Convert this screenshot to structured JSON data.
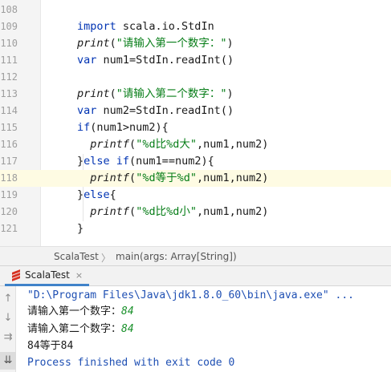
{
  "editor": {
    "lines": [
      {
        "num": "108",
        "tokens": []
      },
      {
        "num": "109",
        "tokens": [
          {
            "t": "kw",
            "v": "import "
          },
          {
            "t": "plain",
            "v": "scala.io.StdIn"
          }
        ]
      },
      {
        "num": "110",
        "tokens": [
          {
            "t": "fn",
            "v": "print"
          },
          {
            "t": "plain",
            "v": "("
          },
          {
            "t": "str",
            "v": "\"请输入第一个数字：\""
          },
          {
            "t": "plain",
            "v": ")"
          }
        ]
      },
      {
        "num": "111",
        "tokens": [
          {
            "t": "kw",
            "v": "var "
          },
          {
            "t": "plain",
            "v": "num1=StdIn.readInt()"
          }
        ]
      },
      {
        "num": "112",
        "tokens": []
      },
      {
        "num": "113",
        "tokens": [
          {
            "t": "fn",
            "v": "print"
          },
          {
            "t": "plain",
            "v": "("
          },
          {
            "t": "str",
            "v": "\"请输入第二个数字：\""
          },
          {
            "t": "plain",
            "v": ")"
          }
        ]
      },
      {
        "num": "114",
        "tokens": [
          {
            "t": "kw",
            "v": "var "
          },
          {
            "t": "plain",
            "v": "num2=StdIn.readInt()"
          }
        ]
      },
      {
        "num": "115",
        "tokens": [
          {
            "t": "kw",
            "v": "if"
          },
          {
            "t": "plain",
            "v": "(num1>num2){"
          }
        ]
      },
      {
        "num": "116",
        "tokens": [
          {
            "t": "plain",
            "v": "  "
          },
          {
            "t": "fn",
            "v": "printf"
          },
          {
            "t": "plain",
            "v": "("
          },
          {
            "t": "str",
            "v": "\"%d比%d大\""
          },
          {
            "t": "plain",
            "v": ",num1,num2)"
          }
        ]
      },
      {
        "num": "117",
        "tokens": [
          {
            "t": "plain",
            "v": "}"
          },
          {
            "t": "kw",
            "v": "else if"
          },
          {
            "t": "plain",
            "v": "(num1==num2){"
          }
        ]
      },
      {
        "num": "118",
        "current": true,
        "tokens": [
          {
            "t": "plain",
            "v": "  "
          },
          {
            "t": "fn",
            "v": "printf"
          },
          {
            "t": "plain",
            "v": "("
          },
          {
            "t": "str",
            "v": "\"%d等于%d\""
          },
          {
            "t": "plain",
            "v": ",num1,num2)"
          }
        ]
      },
      {
        "num": "119",
        "tokens": [
          {
            "t": "plain",
            "v": "}"
          },
          {
            "t": "kw",
            "v": "else"
          },
          {
            "t": "plain",
            "v": "{"
          }
        ]
      },
      {
        "num": "120",
        "tokens": [
          {
            "t": "plain",
            "v": "  "
          },
          {
            "t": "fn",
            "v": "printf"
          },
          {
            "t": "plain",
            "v": "("
          },
          {
            "t": "str",
            "v": "\"%d比%d小\""
          },
          {
            "t": "plain",
            "v": ",num1,num2)"
          }
        ]
      },
      {
        "num": "121",
        "tokens": [
          {
            "t": "plain",
            "v": "}"
          }
        ]
      }
    ]
  },
  "breadcrumb": {
    "object": "ScalaTest",
    "method": "main(args: Array[String])"
  },
  "run_panel": {
    "tab_label": "ScalaTest",
    "close_glyph": "×",
    "side_buttons": [
      {
        "icon": "arrow-up-icon",
        "glyph": "↑"
      },
      {
        "icon": "arrow-down-icon",
        "glyph": "↓"
      },
      {
        "icon": "soft-wrap-icon",
        "glyph": "⇉"
      },
      {
        "icon": "scroll-to-end-icon",
        "glyph": "⇊"
      }
    ],
    "console": {
      "command": "\"D:\\Program Files\\Java\\jdk1.8.0_60\\bin\\java.exe\" ...",
      "prompt1": "请输入第一个数字：",
      "input1": "84",
      "prompt2": "请输入第二个数字：",
      "input2": "84",
      "result": "84等于84",
      "exit": "Process finished with exit code 0"
    }
  },
  "colors": {
    "keyword": "#0033b3",
    "string": "#067d17",
    "user_input": "#19902a",
    "console_link": "#1e4fb3",
    "current_line": "#fefbe3",
    "tab_accent": "#4083c9"
  }
}
